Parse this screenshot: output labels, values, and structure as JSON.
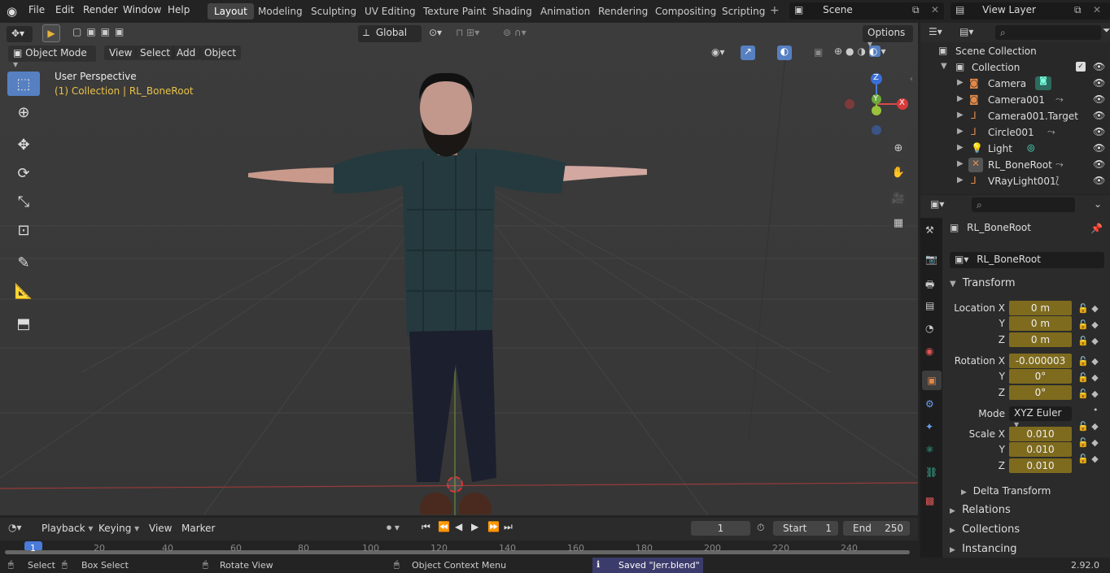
{
  "menu": [
    "File",
    "Edit",
    "Render",
    "Window",
    "Help"
  ],
  "workspaces": [
    "Layout",
    "Modeling",
    "Sculpting",
    "UV Editing",
    "Texture Paint",
    "Shading",
    "Animation",
    "Rendering",
    "Compositing",
    "Scripting"
  ],
  "scene_name": "Scene",
  "view_layer": "View Layer",
  "toolbar": {
    "orientation": "Global",
    "options": "Options",
    "mode": "Object Mode",
    "view": "View",
    "select": "Select",
    "add": "Add",
    "object": "Object"
  },
  "viewport": {
    "title": "User Perspective",
    "subtitle": "(1) Collection | RL_BoneRoot",
    "axis_x": "X",
    "axis_y": "Y",
    "axis_z": "Z"
  },
  "outliner": {
    "root": "Scene Collection",
    "collection": "Collection",
    "items": [
      {
        "name": "Camera",
        "icon": "camera-icon"
      },
      {
        "name": "Camera001",
        "icon": "camera-icon"
      },
      {
        "name": "Camera001.Target",
        "icon": "empty-icon"
      },
      {
        "name": "Circle001",
        "icon": "empty-icon"
      },
      {
        "name": "Light",
        "icon": "light-icon"
      },
      {
        "name": "RL_BoneRoot",
        "icon": "armature-icon"
      },
      {
        "name": "VRayLight001",
        "icon": "empty-icon"
      }
    ]
  },
  "properties": {
    "object_name": "RL_BoneRoot",
    "data_name": "RL_BoneRoot",
    "transform_label": "Transform",
    "location_label": "Location X",
    "location": [
      "0 m",
      "0 m",
      "0 m"
    ],
    "rotation_label": "Rotation X",
    "rotation": [
      "-0.000003",
      "0°",
      "0°"
    ],
    "mode_label": "Mode",
    "mode_value": "XYZ Euler",
    "scale_label": "Scale X",
    "scale": [
      "0.010",
      "0.010",
      "0.010"
    ],
    "y_label": "Y",
    "z_label": "Z",
    "delta": "Delta Transform",
    "relations": "Relations",
    "collections": "Collections",
    "instancing": "Instancing"
  },
  "timeline": {
    "playback": "Playback",
    "keying": "Keying",
    "view": "View",
    "marker": "Marker",
    "current_frame": "1",
    "start_label": "Start",
    "start": "1",
    "end_label": "End",
    "end": "250",
    "ticks": [
      "1",
      "20",
      "40",
      "60",
      "80",
      "100",
      "120",
      "140",
      "160",
      "180",
      "200",
      "220",
      "240"
    ]
  },
  "status": {
    "select": "Select",
    "box_select": "Box Select",
    "rotate_view": "Rotate View",
    "context_menu": "Object Context Menu",
    "message": "Saved \"Jerr.blend\"",
    "version": "2.92.0"
  }
}
